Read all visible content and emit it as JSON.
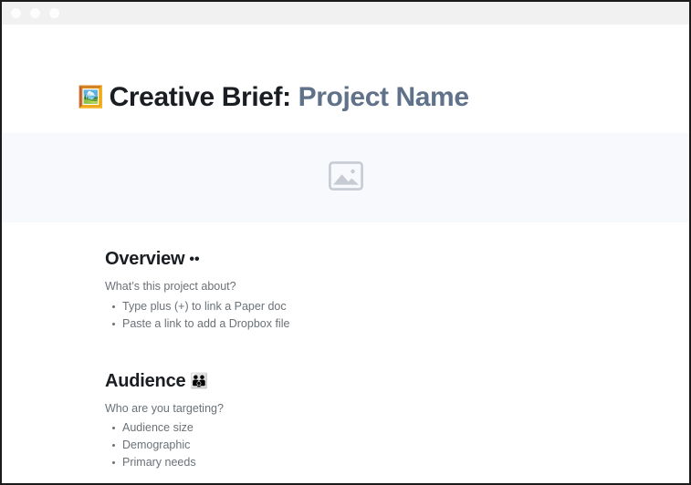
{
  "window": {
    "traffic_lights": [
      "close",
      "minimize",
      "maximize"
    ]
  },
  "document": {
    "title_emoji": "🖼️",
    "title_emoji_name": "framed-picture-emoji",
    "title_static": "Creative Brief:",
    "title_placeholder": "Project Name",
    "cover": {
      "icon_name": "image-placeholder-icon",
      "background_color": "#f7f9fd",
      "icon_color": "#c6cbd4"
    },
    "sections": [
      {
        "heading": "Overview",
        "heading_emoji": "••",
        "heading_emoji_name": "eyes-emoji",
        "prompt": "What’s this project about?",
        "items": [
          "Type plus (+) to link a Paper doc",
          "Paste a link to add a Dropbox file"
        ]
      },
      {
        "heading": "Audience",
        "heading_emoji": "👪",
        "heading_emoji_name": "family-emoji",
        "prompt": "Who are you targeting?",
        "items": [
          "Audience size",
          "Demographic",
          "Primary needs"
        ]
      }
    ]
  },
  "colors": {
    "titlebar": "#f1f1f1",
    "heading_text": "#1a1d21",
    "body_text": "#6b7177",
    "placeholder_text": "#60718a",
    "banner": "#f7f9fd",
    "border": "#1b1b1b"
  }
}
